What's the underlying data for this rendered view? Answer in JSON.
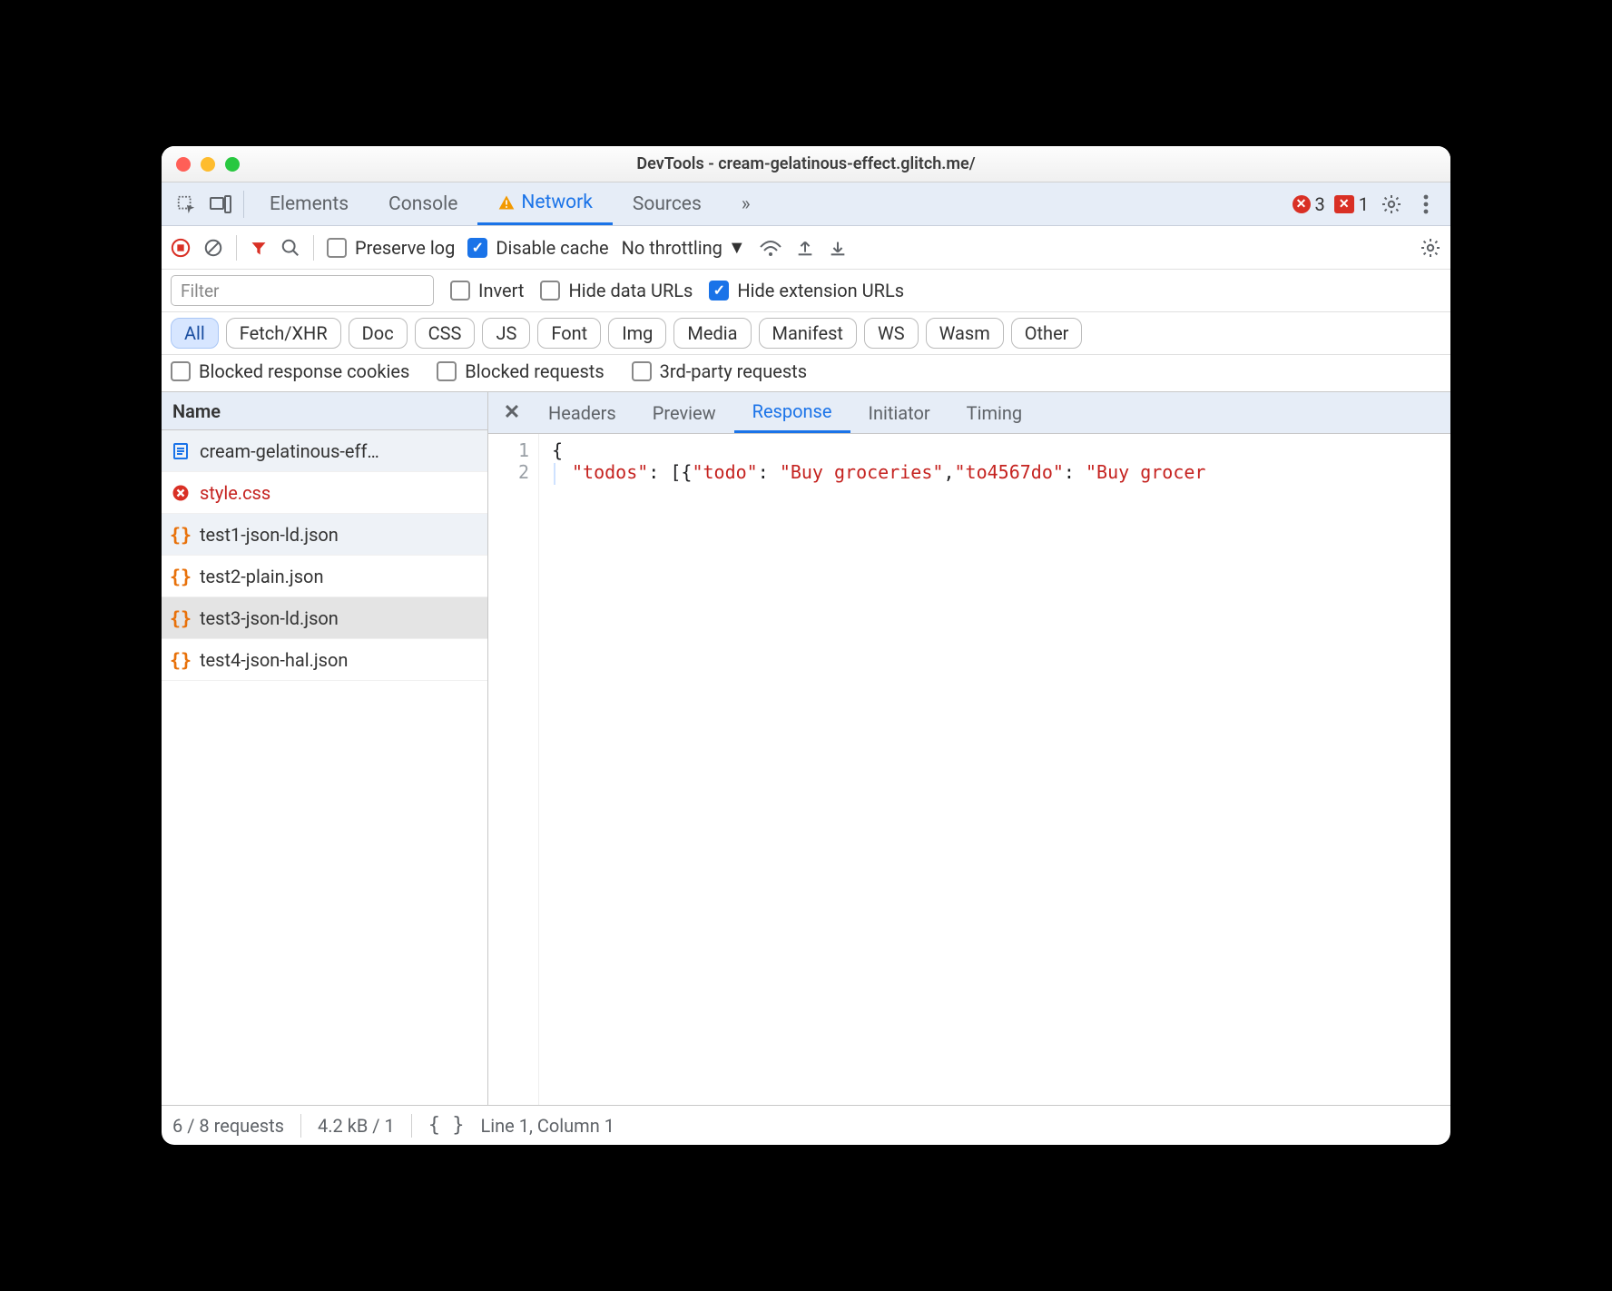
{
  "window": {
    "title": "DevTools - cream-gelatinous-effect.glitch.me/"
  },
  "tabs": {
    "elements": "Elements",
    "console": "Console",
    "network": "Network",
    "sources": "Sources",
    "more": "»"
  },
  "error_badge": {
    "count": "3"
  },
  "issue_badge": {
    "count": "1"
  },
  "toolbar": {
    "preserve_log": "Preserve log",
    "disable_cache": "Disable cache",
    "throttling": "No throttling"
  },
  "filter": {
    "placeholder": "Filter",
    "invert": "Invert",
    "hide_data_urls": "Hide data URLs",
    "hide_ext_urls": "Hide extension URLs"
  },
  "chips": {
    "all": "All",
    "fetchxhr": "Fetch/XHR",
    "doc": "Doc",
    "css": "CSS",
    "js": "JS",
    "font": "Font",
    "img": "Img",
    "media": "Media",
    "manifest": "Manifest",
    "ws": "WS",
    "wasm": "Wasm",
    "other": "Other"
  },
  "blocked": {
    "response_cookies": "Blocked response cookies",
    "requests": "Blocked requests",
    "third_party": "3rd-party requests"
  },
  "reqlist": {
    "header": "Name",
    "items": [
      {
        "name": "cream-gelatinous-eff…",
        "kind": "document",
        "state": "even"
      },
      {
        "name": "style.css",
        "kind": "error",
        "state": "error"
      },
      {
        "name": "test1-json-ld.json",
        "kind": "json",
        "state": "even"
      },
      {
        "name": "test2-plain.json",
        "kind": "json",
        "state": ""
      },
      {
        "name": "test3-json-ld.json",
        "kind": "json",
        "state": "selected"
      },
      {
        "name": "test4-json-hal.json",
        "kind": "json",
        "state": ""
      }
    ]
  },
  "detail_tabs": {
    "headers": "Headers",
    "preview": "Preview",
    "response": "Response",
    "initiator": "Initiator",
    "timing": "Timing"
  },
  "response_code": {
    "line_numbers": [
      "1",
      "2"
    ],
    "line1": "{",
    "line2_key1": "\"todos\"",
    "line2_punc1": ": [{",
    "line2_key2": "\"todo\"",
    "line2_punc2": ": ",
    "line2_str1": "\"Buy groceries\"",
    "line2_punc3": ",",
    "line2_key3": "\"to4567do\"",
    "line2_punc4": ": ",
    "line2_str2": "\"Buy grocer"
  },
  "status": {
    "requests": "6 / 8 requests",
    "transfer": "4.2 kB / 1",
    "cursor": "Line 1, Column 1"
  }
}
